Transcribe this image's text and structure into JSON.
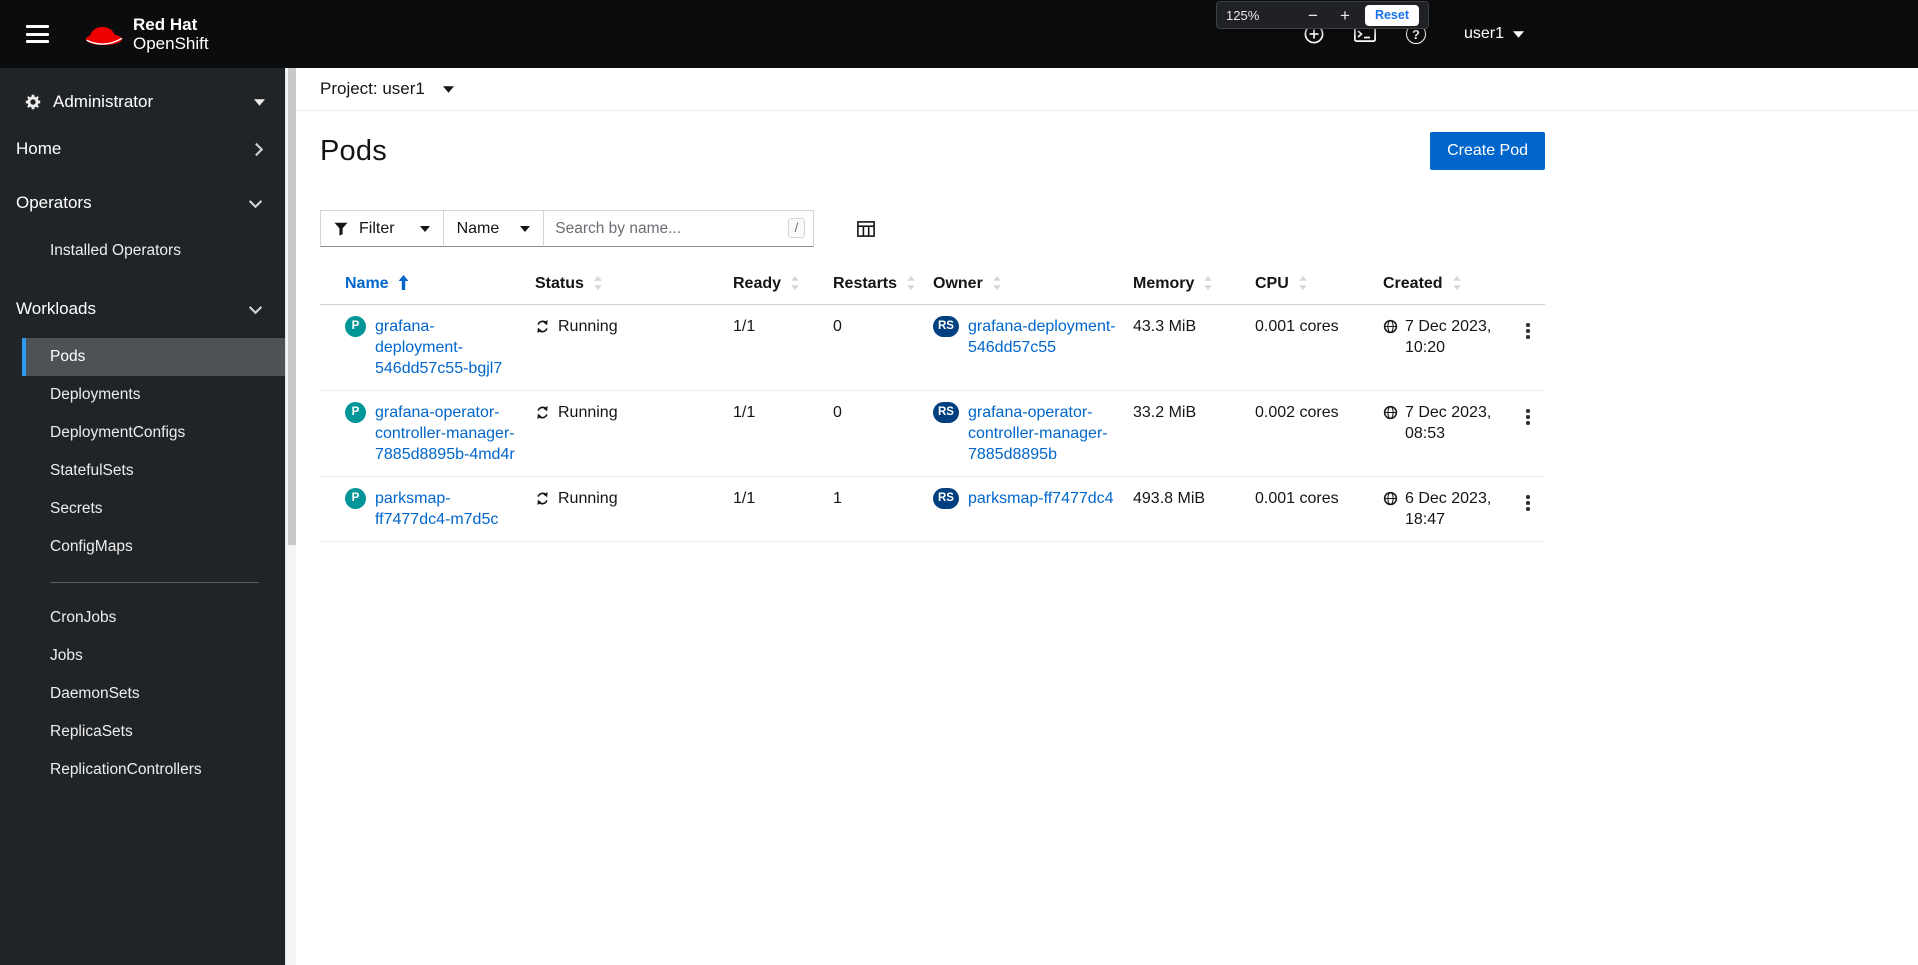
{
  "masthead": {
    "brand": {
      "line1": "Red Hat",
      "line2": "OpenShift"
    },
    "icons": [
      "quick-create",
      "web-terminal",
      "help"
    ],
    "user_menu": "user1"
  },
  "browser_zoom_popup": {
    "level": "125%",
    "zoom_out": "−",
    "zoom_in": "+",
    "reset": "Reset"
  },
  "sidebar": {
    "perspective": "Administrator",
    "nav": [
      {
        "label": "Home",
        "state": "collapsed",
        "items": []
      },
      {
        "label": "Operators",
        "state": "expanded",
        "items": [
          {
            "label": "Installed Operators"
          }
        ]
      },
      {
        "label": "Workloads",
        "state": "expanded",
        "items": [
          {
            "label": "Pods",
            "active": true
          },
          {
            "label": "Deployments"
          },
          {
            "label": "DeploymentConfigs"
          },
          {
            "label": "StatefulSets"
          },
          {
            "label": "Secrets"
          },
          {
            "label": "ConfigMaps",
            "divider_after": true
          },
          {
            "label": "CronJobs"
          },
          {
            "label": "Jobs"
          },
          {
            "label": "DaemonSets"
          },
          {
            "label": "ReplicaSets"
          },
          {
            "label": "ReplicationControllers"
          }
        ]
      }
    ]
  },
  "project_bar": {
    "label": "Project: user1"
  },
  "page": {
    "title": "Pods",
    "create_button": "Create Pod"
  },
  "toolbar": {
    "filter_label": "Filter",
    "attribute_label": "Name",
    "search_placeholder": "Search by name...",
    "search_shortcut": "/"
  },
  "table": {
    "columns": [
      {
        "label": "Name",
        "sorted": "asc"
      },
      {
        "label": "Status"
      },
      {
        "label": "Ready"
      },
      {
        "label": "Restarts"
      },
      {
        "label": "Owner"
      },
      {
        "label": "Memory"
      },
      {
        "label": "CPU"
      },
      {
        "label": "Created"
      }
    ],
    "rows": [
      {
        "badge": "P",
        "name": "grafana-deployment-546dd57c55-bgjl7",
        "status": "Running",
        "ready": "1/1",
        "restarts": "0",
        "owner_badge": "RS",
        "owner": "grafana-deployment-546dd57c55",
        "memory": "43.3 MiB",
        "cpu": "0.001 cores",
        "created": "7 Dec 2023, 10:20"
      },
      {
        "badge": "P",
        "name": "grafana-operator-controller-manager-7885d8895b-4md4r",
        "status": "Running",
        "ready": "1/1",
        "restarts": "0",
        "owner_badge": "RS",
        "owner": "grafana-operator-controller-manager-7885d8895b",
        "memory": "33.2 MiB",
        "cpu": "0.002 cores",
        "created": "7 Dec 2023, 08:53"
      },
      {
        "badge": "P",
        "name": "parksmap-ff7477dc4-m7d5c",
        "status": "Running",
        "ready": "1/1",
        "restarts": "1",
        "owner_badge": "RS",
        "owner": "parksmap-ff7477dc4",
        "memory": "493.8 MiB",
        "cpu": "0.001 cores",
        "created": "6 Dec 2023, 18:47"
      }
    ]
  },
  "colors": {
    "link": "#0066cc",
    "primary": "#0066cc",
    "pod_badge": "#009596",
    "rs_badge": "#004080",
    "nav_active": "#2b9af3",
    "masthead_bg": "#0b0c0d",
    "sidebar_bg": "#212427"
  },
  "icons": {
    "hamburger": "menu-bars",
    "quick_create": "plus-circle",
    "web_terminal": "command-line",
    "help": "question-circle",
    "project_caret": "caret-down",
    "filter": "funnel",
    "column_management": "table-columns",
    "status_running": "sync",
    "created": "globe",
    "row_actions": "kebab-vertical-dots",
    "sorted_asc": "arrow-up",
    "sortable": "arrows-up-down"
  }
}
